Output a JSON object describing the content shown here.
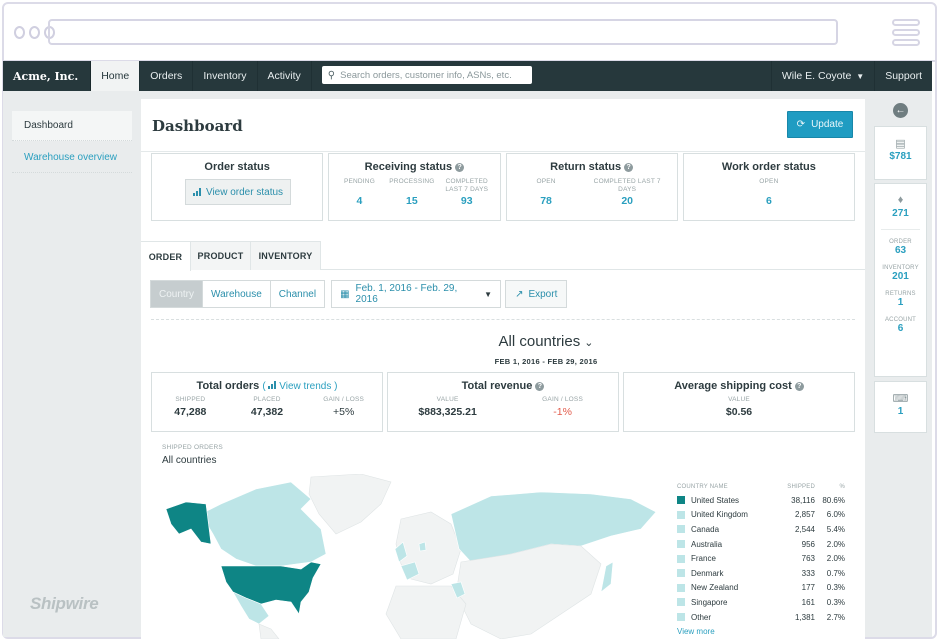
{
  "browser": {
    "url": ""
  },
  "nav": {
    "brand": "Acme, Inc.",
    "items": [
      {
        "label": "Home",
        "active": true
      },
      {
        "label": "Orders"
      },
      {
        "label": "Inventory"
      },
      {
        "label": "Activity"
      }
    ],
    "search_placeholder": "Search orders, customer info, ASNs, etc.",
    "user": "Wile E. Coyote",
    "support": "Support"
  },
  "sidebar": {
    "items": [
      {
        "label": "Dashboard",
        "active": true
      },
      {
        "label": "Warehouse overview"
      }
    ],
    "logo": "Shipwire"
  },
  "page": {
    "title": "Dashboard",
    "update_label": "Update"
  },
  "status_cards": {
    "order": {
      "title": "Order status",
      "button": "View order status"
    },
    "receiving": {
      "title": "Receiving status",
      "metrics": [
        {
          "label": "PENDING",
          "value": "4"
        },
        {
          "label": "PROCESSING",
          "value": "15"
        },
        {
          "label": "COMPLETED LAST 7 DAYS",
          "value": "93"
        }
      ]
    },
    "returns": {
      "title": "Return status",
      "metrics": [
        {
          "label": "OPEN",
          "value": "78"
        },
        {
          "label": "COMPLETED LAST 7 DAYS",
          "value": "20"
        }
      ]
    },
    "work_order": {
      "title": "Work order status",
      "metrics": [
        {
          "label": "OPEN",
          "value": "6"
        }
      ]
    }
  },
  "tabs": [
    {
      "label": "ORDER",
      "active": true
    },
    {
      "label": "PRODUCT"
    },
    {
      "label": "INVENTORY"
    }
  ],
  "filters": {
    "segments": [
      {
        "label": "Country",
        "active": true
      },
      {
        "label": "Warehouse"
      },
      {
        "label": "Channel"
      }
    ],
    "date_range": "Feb. 1, 2016 - Feb. 29, 2016",
    "export_label": "Export"
  },
  "region": {
    "title": "All countries",
    "date": "FEB 1, 2016 - FEB 29, 2016"
  },
  "kpis": {
    "orders": {
      "title": "Total orders",
      "link": "View trends",
      "metrics": [
        {
          "label": "SHIPPED",
          "value": "47,288"
        },
        {
          "label": "PLACED",
          "value": "47,382"
        },
        {
          "label": "GAIN / LOSS",
          "value": "+5%"
        }
      ]
    },
    "revenue": {
      "title": "Total revenue",
      "metrics": [
        {
          "label": "VALUE",
          "value": "$883,325.21"
        },
        {
          "label": "GAIN / LOSS",
          "value": "-1%"
        }
      ]
    },
    "shipping": {
      "title": "Average shipping cost",
      "metrics": [
        {
          "label": "VALUE",
          "value": "$0.56"
        }
      ]
    }
  },
  "map": {
    "label": "SHIPPED ORDERS",
    "subtitle": "All countries",
    "colors": {
      "high": "#0e8585",
      "low": "#bde5e7",
      "none": "#f1f3f3"
    }
  },
  "legend": {
    "headers": {
      "name": "COUNTRY NAME",
      "shipped": "SHIPPED",
      "pct": "%"
    },
    "rows": [
      {
        "name": "United States",
        "shipped": "38,116",
        "pct": "80.6%",
        "color": "#0e8585"
      },
      {
        "name": "United Kingdom",
        "shipped": "2,857",
        "pct": "6.0%",
        "color": "#bde5e7"
      },
      {
        "name": "Canada",
        "shipped": "2,544",
        "pct": "5.4%",
        "color": "#bde5e7"
      },
      {
        "name": "Australia",
        "shipped": "956",
        "pct": "2.0%",
        "color": "#bde5e7"
      },
      {
        "name": "France",
        "shipped": "763",
        "pct": "2.0%",
        "color": "#bde5e7"
      },
      {
        "name": "Denmark",
        "shipped": "333",
        "pct": "0.7%",
        "color": "#bde5e7"
      },
      {
        "name": "New Zealand",
        "shipped": "177",
        "pct": "0.3%",
        "color": "#bde5e7"
      },
      {
        "name": "Singapore",
        "shipped": "161",
        "pct": "0.3%",
        "color": "#bde5e7"
      },
      {
        "name": "Other",
        "shipped": "1,381",
        "pct": "2.7%",
        "color": "#bde5e7"
      }
    ],
    "view_more": "View more"
  },
  "rail": {
    "billing": "$781",
    "notifications": "271",
    "counts": [
      {
        "label": "ORDER",
        "value": "63"
      },
      {
        "label": "INVENTORY",
        "value": "201"
      },
      {
        "label": "RETURNS",
        "value": "1"
      },
      {
        "label": "ACCOUNT",
        "value": "6"
      }
    ],
    "messages": "1"
  }
}
